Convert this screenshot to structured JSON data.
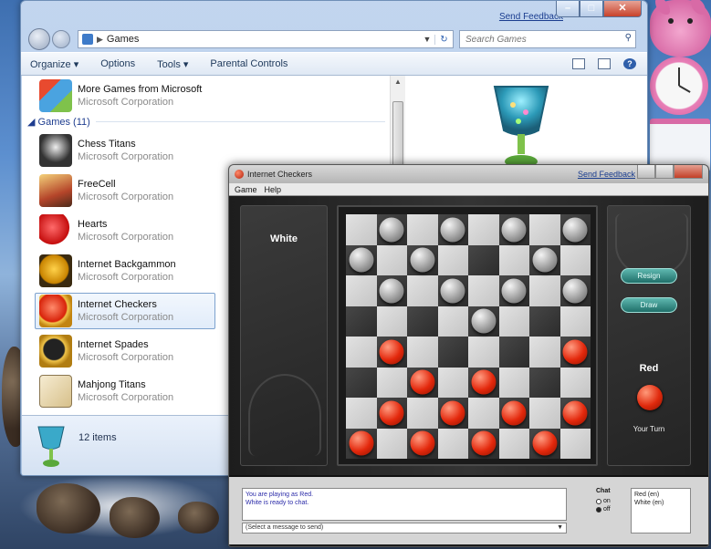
{
  "explorer": {
    "send_feedback": "Send Feedback",
    "address": {
      "path": "Games"
    },
    "search": {
      "placeholder": "Search Games"
    },
    "toolbar": {
      "organize": "Organize ▾",
      "options": "Options",
      "tools": "Tools ▾",
      "parental": "Parental Controls"
    },
    "more_games": {
      "name": "More Games from Microsoft",
      "company": "Microsoft Corporation"
    },
    "group_header": "◢ Games (11)",
    "games": [
      {
        "name": "Chess Titans",
        "company": "Microsoft Corporation"
      },
      {
        "name": "FreeCell",
        "company": "Microsoft Corporation"
      },
      {
        "name": "Hearts",
        "company": "Microsoft Corporation"
      },
      {
        "name": "Internet Backgammon",
        "company": "Microsoft Corporation"
      },
      {
        "name": "Internet Checkers",
        "company": "Microsoft Corporation"
      },
      {
        "name": "Internet Spades",
        "company": "Microsoft Corporation"
      },
      {
        "name": "Mahjong Titans",
        "company": "Microsoft Corporation"
      }
    ],
    "selected_game": "Internet Checkers",
    "status": {
      "item_count": "12 items"
    }
  },
  "checkers": {
    "title": "Internet Checkers",
    "send_feedback": "Send Feedback",
    "menu": {
      "game": "Game",
      "help": "Help"
    },
    "opponent_label": "White",
    "player_label": "Red",
    "turn_label": "Your Turn",
    "buttons": {
      "resign": "Resign",
      "draw": "Draw"
    },
    "board": {
      "white_pieces": [
        [
          0,
          1
        ],
        [
          0,
          3
        ],
        [
          0,
          5
        ],
        [
          0,
          7
        ],
        [
          1,
          0
        ],
        [
          1,
          2
        ],
        [
          1,
          6
        ],
        [
          2,
          1
        ],
        [
          2,
          3
        ],
        [
          2,
          5
        ],
        [
          2,
          7
        ],
        [
          3,
          4
        ]
      ],
      "red_pieces": [
        [
          4,
          1
        ],
        [
          4,
          7
        ],
        [
          5,
          2
        ],
        [
          5,
          4
        ],
        [
          6,
          1
        ],
        [
          6,
          3
        ],
        [
          6,
          5
        ],
        [
          6,
          7
        ],
        [
          7,
          0
        ],
        [
          7,
          2
        ],
        [
          7,
          4
        ],
        [
          7,
          6
        ]
      ]
    },
    "chat": {
      "log_line1": "You are playing as Red.",
      "log_line2": "White is ready to chat.",
      "select": "(Select a message to send)",
      "label": "Chat",
      "on": "on",
      "off": "off",
      "player1": "Red (en)",
      "player2": "White (en)"
    }
  },
  "colors": {
    "red_piece": "#e3280c",
    "white_piece": "#c8c8c8",
    "link": "#1a3d8f"
  }
}
